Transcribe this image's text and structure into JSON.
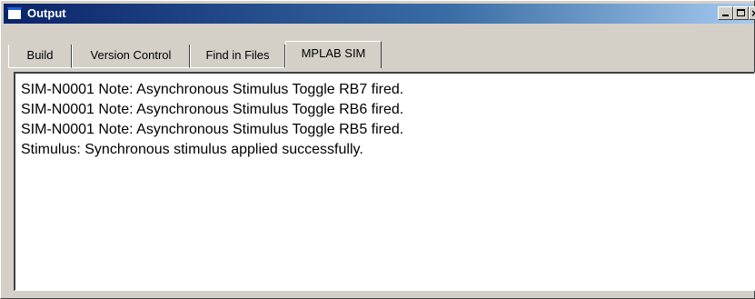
{
  "window": {
    "title": "Output",
    "controls": {
      "minimize": "_",
      "maximize": "",
      "close": "×"
    }
  },
  "tabs": [
    {
      "label": "Build",
      "active": false
    },
    {
      "label": "Version Control",
      "active": false
    },
    {
      "label": "Find in Files",
      "active": false
    },
    {
      "label": "MPLAB SIM",
      "active": true
    }
  ],
  "output": {
    "lines": [
      "SIM-N0001 Note: Asynchronous Stimulus Toggle RB7 fired.",
      "SIM-N0001 Note: Asynchronous Stimulus Toggle RB6 fired.",
      "SIM-N0001 Note: Asynchronous Stimulus Toggle RB5 fired.",
      "Stimulus: Synchronous stimulus applied successfully."
    ]
  },
  "colors": {
    "titlebar_start": "#0a246a",
    "titlebar_end": "#a6caf0",
    "face": "#d4d0c8",
    "output_bg": "#ffffff"
  }
}
